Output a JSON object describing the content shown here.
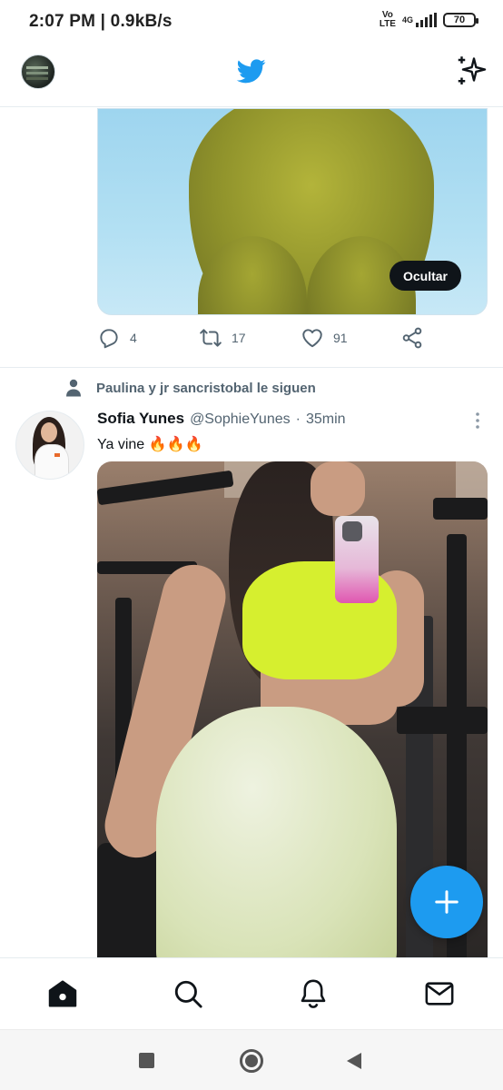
{
  "status_bar": {
    "time": "2:07 PM | 0.9kB/s",
    "volte_top": "Vo",
    "volte_bottom": "LTE",
    "network": "4G",
    "battery": "70"
  },
  "header": {
    "profile_icon": "profile-avatar",
    "logo_icon": "twitter-bird-icon",
    "sparkle_icon": "sparkle-icon"
  },
  "tweet_1": {
    "hide_label": "Ocultar",
    "replies": "4",
    "retweets": "17",
    "likes": "91"
  },
  "tweet_2": {
    "social_context": "Paulina y jr sancristobal le siguen",
    "name": "Sofia Yunes",
    "handle": "@SophieYunes",
    "separator": "·",
    "time": "35min",
    "text": "Ya vine 🔥🔥🔥"
  },
  "colors": {
    "accent": "#1d9bf0",
    "text_primary": "#0f1419",
    "text_secondary": "#536471",
    "divider": "#e6ecf0"
  },
  "bottom_nav": [
    "home-icon",
    "search-icon",
    "notifications-icon",
    "messages-icon"
  ],
  "system_nav": [
    "recents-square-icon",
    "home-circle-icon",
    "back-triangle-icon"
  ]
}
